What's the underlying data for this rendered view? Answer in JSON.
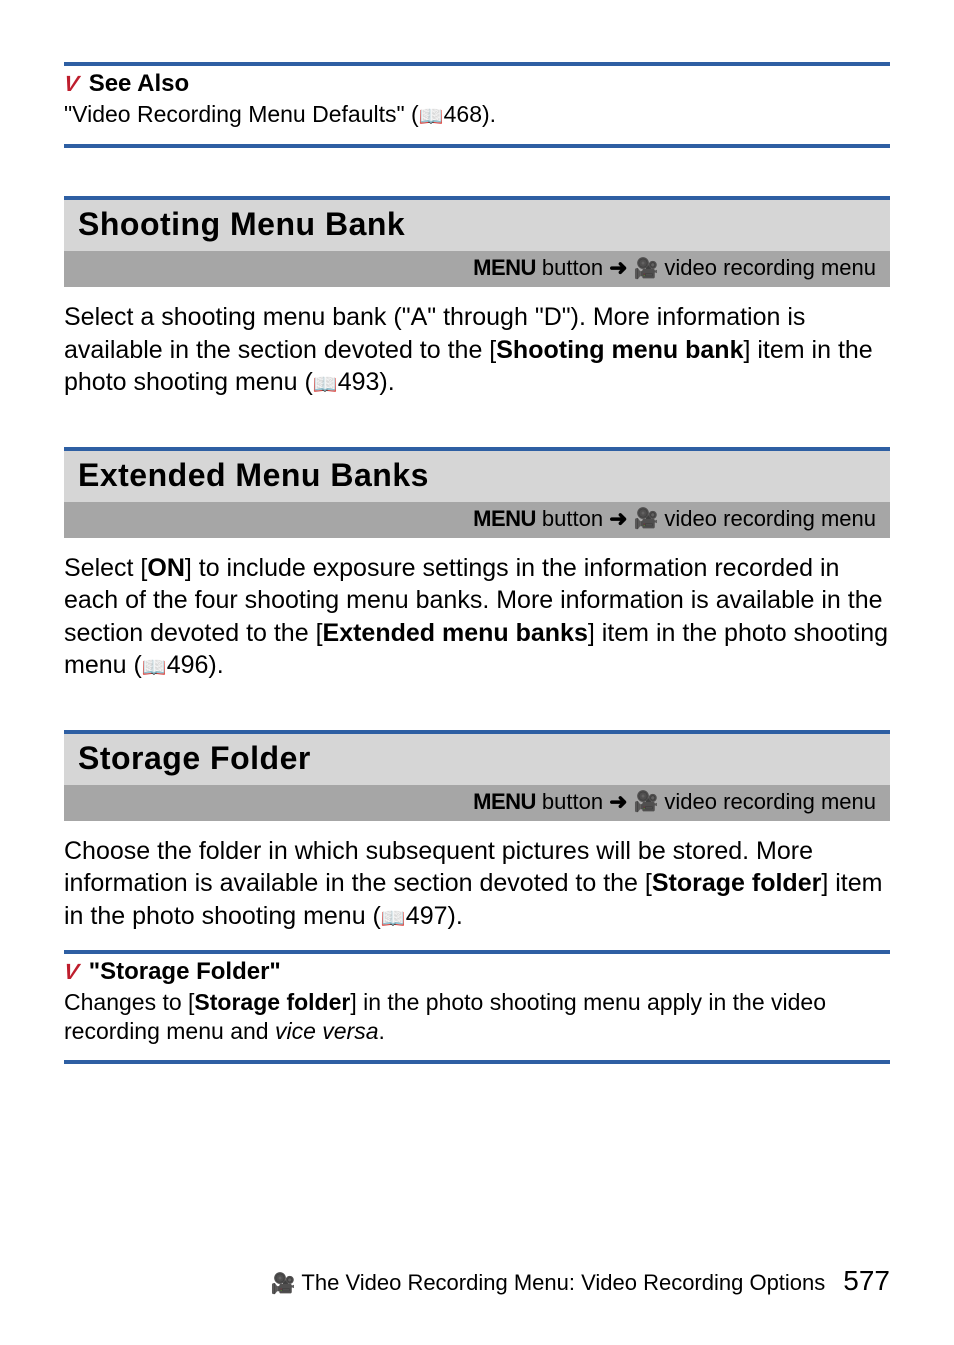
{
  "notes": {
    "seeAlso": {
      "title": "See Also",
      "body_prefix": "\"Video Recording Menu Defaults\" (",
      "body_ref": "468).",
      "book_icon": "📖"
    },
    "storageFolder": {
      "title": "\"Storage Folder\"",
      "body_1": "Changes to [",
      "body_bold": "Storage folder",
      "body_2": "] in the photo shooting menu apply in the video recording menu and ",
      "body_italic": "vice versa",
      "body_3": "."
    }
  },
  "sections": {
    "shootingMenuBank": {
      "title": "Shooting Menu Bank",
      "sub_menu": "MENU",
      "sub_btn": " button ",
      "sub_trail": "  video recording menu",
      "body_1": "Select a shooting menu bank (\"A\" through \"D\"). More information is available in the section devoted to the [",
      "body_bold": "Shooting menu bank",
      "body_2": "] item in the photo shooting menu (",
      "body_ref": "493)."
    },
    "extendedMenuBanks": {
      "title": "Extended Menu Banks",
      "sub_menu": "MENU",
      "sub_btn": " button ",
      "sub_trail": "  video recording menu",
      "body_1a": "Select [",
      "body_bold_on": "ON",
      "body_1b": "] to include exposure settings in the information recorded in each of the four shooting menu banks. More information is available in the section devoted to the [",
      "body_bold": "Extended menu banks",
      "body_2": "] item in the photo shooting menu (",
      "body_ref": "496)."
    },
    "storageFolder": {
      "title": "Storage Folder",
      "sub_menu": "MENU",
      "sub_btn": " button ",
      "sub_trail": "  video recording menu",
      "body_1": "Choose the folder in which subsequent pictures will be stored. More information is available in the section devoted to the [",
      "body_bold": "Storage folder",
      "body_2": "] item in the photo shooting menu (",
      "body_ref": "497)."
    }
  },
  "footer": {
    "icon": "🎥",
    "text": " The Video Recording Menu: Video Recording Options",
    "page": "577"
  },
  "glyphs": {
    "v": "V",
    "arrow": "➜",
    "video": "🎥",
    "book": "📖"
  }
}
